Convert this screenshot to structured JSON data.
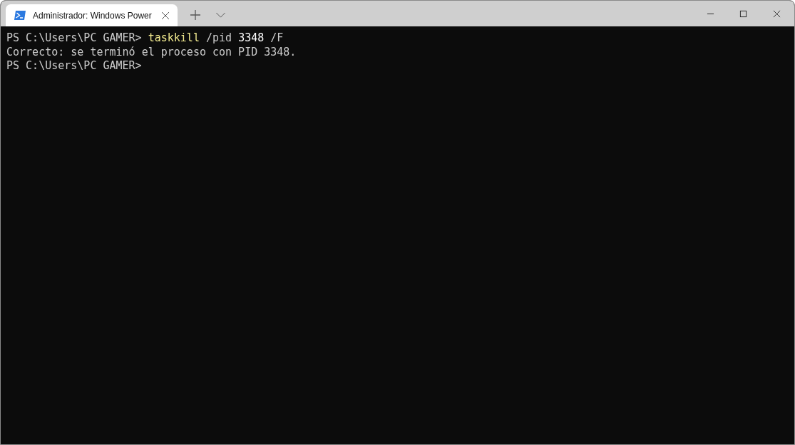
{
  "window": {
    "tabs": [
      {
        "title": "Administrador: Windows Power",
        "selected": true
      }
    ]
  },
  "terminal": {
    "lines": [
      {
        "segments": [
          {
            "kind": "prompt",
            "text": "PS C:\\Users\\PC GAMER> "
          },
          {
            "kind": "command",
            "text": "taskkill"
          },
          {
            "kind": "argument",
            "text": " /pid "
          },
          {
            "kind": "number",
            "text": "3348"
          },
          {
            "kind": "argument",
            "text": " /F"
          }
        ]
      },
      {
        "segments": [
          {
            "kind": "output",
            "text": "Correcto: se terminó el proceso con PID 3348."
          }
        ]
      },
      {
        "segments": [
          {
            "kind": "prompt",
            "text": "PS C:\\Users\\PC GAMER>"
          }
        ]
      }
    ]
  }
}
